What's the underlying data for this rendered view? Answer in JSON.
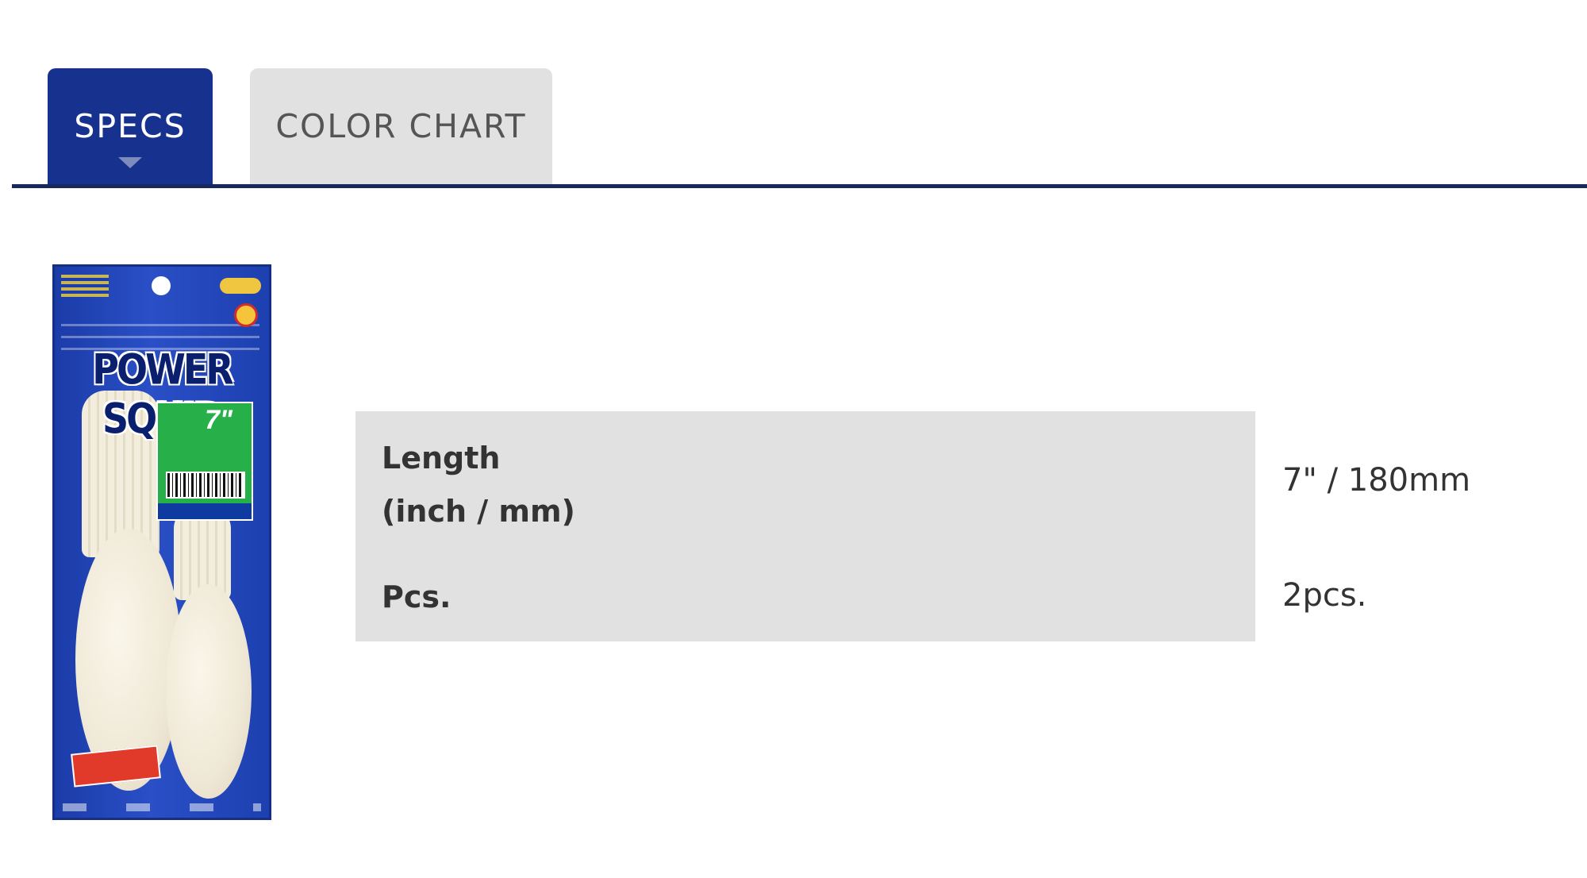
{
  "tabs": [
    {
      "label": "SPECS",
      "active": true
    },
    {
      "label": "COLOR CHART",
      "active": false
    }
  ],
  "colors": {
    "active_tab": "#16328e",
    "inactive_tab": "#e1e1e1",
    "rule": "#16285e",
    "label_bg": "#e1e1e1",
    "text": "#333333"
  },
  "product": {
    "package_title": "POWER SQUID",
    "package_size": "7\""
  },
  "specs": {
    "rows": [
      {
        "label_line1": "Length",
        "label_line2": "(inch / mm)",
        "value": "7\" / 180mm"
      },
      {
        "label": "Pcs.",
        "value": "2pcs."
      }
    ]
  }
}
